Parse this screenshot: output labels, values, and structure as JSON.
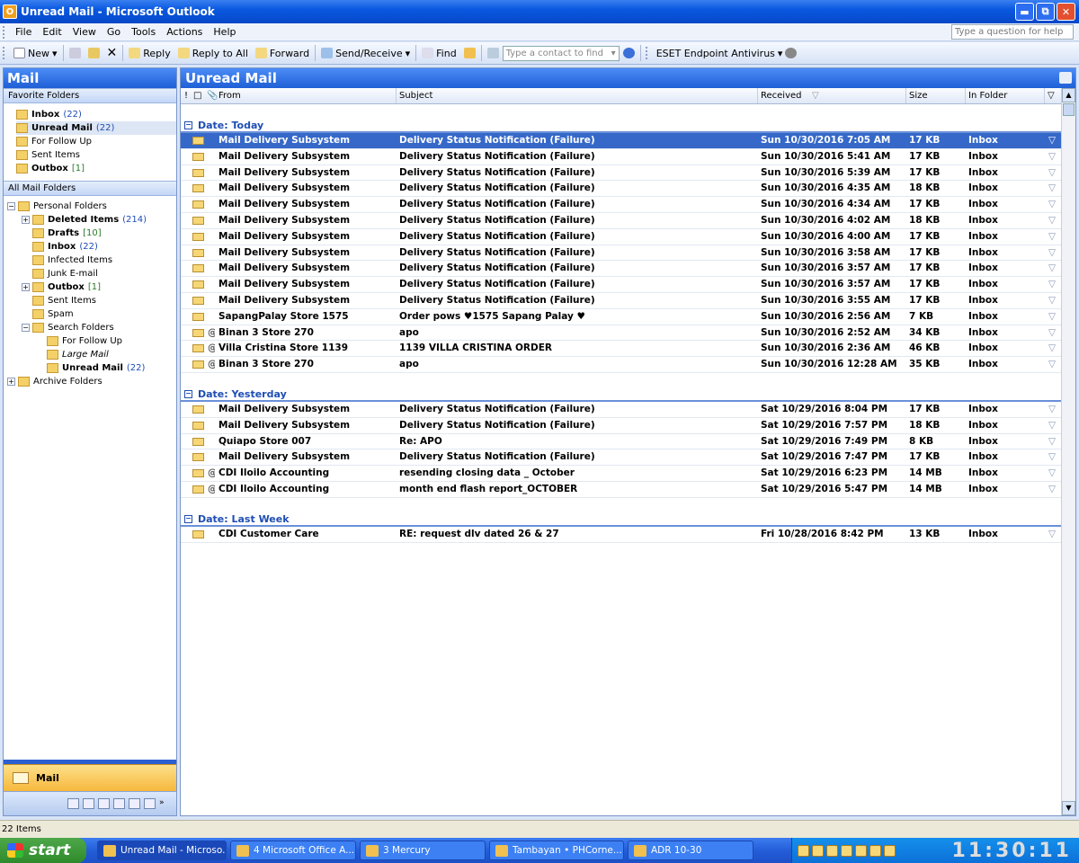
{
  "window": {
    "title": "Unread Mail - Microsoft Outlook",
    "app_glyph": "O"
  },
  "menu": [
    "File",
    "Edit",
    "View",
    "Go",
    "Tools",
    "Actions",
    "Help"
  ],
  "help_placeholder": "Type a question for help",
  "toolbar": {
    "new": "New",
    "reply": "Reply",
    "reply_all": "Reply to All",
    "forward": "Forward",
    "send_receive": "Send/Receive",
    "find": "Find",
    "contact_placeholder": "Type a contact to find",
    "eset": "ESET Endpoint Antivirus"
  },
  "nav": {
    "title": "Mail",
    "favorites_header": "Favorite Folders",
    "favorites": [
      {
        "label": "Inbox",
        "count": "(22)",
        "bold": true
      },
      {
        "label": "Unread Mail",
        "count": "(22)",
        "bold": true
      },
      {
        "label": "For Follow Up",
        "count": "",
        "bold": false
      },
      {
        "label": "Sent Items",
        "count": "",
        "bold": false
      },
      {
        "label": "Outbox",
        "count": "[1]",
        "bold": true
      }
    ],
    "all_header": "All Mail Folders",
    "tree": [
      {
        "label": "Personal Folders",
        "count": "",
        "bold": false,
        "level": 0,
        "exp": "⊟"
      },
      {
        "label": "Deleted Items",
        "count": "(214)",
        "bold": true,
        "level": 1,
        "exp": "⊞"
      },
      {
        "label": "Drafts",
        "count": "[10]",
        "bold": true,
        "level": 1,
        "exp": ""
      },
      {
        "label": "Inbox",
        "count": "(22)",
        "bold": true,
        "level": 1,
        "exp": ""
      },
      {
        "label": "Infected Items",
        "count": "",
        "bold": false,
        "level": 1,
        "exp": ""
      },
      {
        "label": "Junk E-mail",
        "count": "",
        "bold": false,
        "level": 1,
        "exp": ""
      },
      {
        "label": "Outbox",
        "count": "[1]",
        "bold": true,
        "level": 1,
        "exp": "⊞"
      },
      {
        "label": "Sent Items",
        "count": "",
        "bold": false,
        "level": 1,
        "exp": ""
      },
      {
        "label": "Spam",
        "count": "",
        "bold": false,
        "level": 1,
        "exp": ""
      },
      {
        "label": "Search Folders",
        "count": "",
        "bold": false,
        "level": 1,
        "exp": "⊟"
      },
      {
        "label": "For Follow Up",
        "count": "",
        "bold": false,
        "level": 2,
        "exp": ""
      },
      {
        "label": "Large Mail",
        "count": "",
        "bold": false,
        "level": 2,
        "exp": "",
        "italic": true
      },
      {
        "label": "Unread Mail",
        "count": "(22)",
        "bold": true,
        "level": 2,
        "exp": ""
      },
      {
        "label": "Archive Folders",
        "count": "",
        "bold": false,
        "level": 0,
        "exp": "⊞"
      }
    ],
    "mail_button": "Mail"
  },
  "list": {
    "title": "Unread Mail",
    "columns": {
      "from": "From",
      "subject": "Subject",
      "received": "Received",
      "size": "Size",
      "folder": "In Folder"
    },
    "groups": [
      {
        "label": "Date: Today",
        "rows": [
          {
            "from": "Mail Delivery Subsystem",
            "subject": "Delivery Status Notification (Failure)",
            "received": "Sun 10/30/2016 7:05 AM",
            "size": "17 KB",
            "folder": "Inbox",
            "attach": false,
            "selected": true
          },
          {
            "from": "Mail Delivery Subsystem",
            "subject": "Delivery Status Notification (Failure)",
            "received": "Sun 10/30/2016 5:41 AM",
            "size": "17 KB",
            "folder": "Inbox",
            "attach": false
          },
          {
            "from": "Mail Delivery Subsystem",
            "subject": "Delivery Status Notification (Failure)",
            "received": "Sun 10/30/2016 5:39 AM",
            "size": "17 KB",
            "folder": "Inbox",
            "attach": false
          },
          {
            "from": "Mail Delivery Subsystem",
            "subject": "Delivery Status Notification (Failure)",
            "received": "Sun 10/30/2016 4:35 AM",
            "size": "18 KB",
            "folder": "Inbox",
            "attach": false
          },
          {
            "from": "Mail Delivery Subsystem",
            "subject": "Delivery Status Notification (Failure)",
            "received": "Sun 10/30/2016 4:34 AM",
            "size": "17 KB",
            "folder": "Inbox",
            "attach": false
          },
          {
            "from": "Mail Delivery Subsystem",
            "subject": "Delivery Status Notification (Failure)",
            "received": "Sun 10/30/2016 4:02 AM",
            "size": "18 KB",
            "folder": "Inbox",
            "attach": false
          },
          {
            "from": "Mail Delivery Subsystem",
            "subject": "Delivery Status Notification (Failure)",
            "received": "Sun 10/30/2016 4:00 AM",
            "size": "17 KB",
            "folder": "Inbox",
            "attach": false
          },
          {
            "from": "Mail Delivery Subsystem",
            "subject": "Delivery Status Notification (Failure)",
            "received": "Sun 10/30/2016 3:58 AM",
            "size": "17 KB",
            "folder": "Inbox",
            "attach": false
          },
          {
            "from": "Mail Delivery Subsystem",
            "subject": "Delivery Status Notification (Failure)",
            "received": "Sun 10/30/2016 3:57 AM",
            "size": "17 KB",
            "folder": "Inbox",
            "attach": false
          },
          {
            "from": "Mail Delivery Subsystem",
            "subject": "Delivery Status Notification (Failure)",
            "received": "Sun 10/30/2016 3:57 AM",
            "size": "17 KB",
            "folder": "Inbox",
            "attach": false
          },
          {
            "from": "Mail Delivery Subsystem",
            "subject": "Delivery Status Notification (Failure)",
            "received": "Sun 10/30/2016 3:55 AM",
            "size": "17 KB",
            "folder": "Inbox",
            "attach": false
          },
          {
            "from": "SapangPalay Store 1575",
            "subject": "Order pows ♥1575 Sapang Palay ♥",
            "received": "Sun 10/30/2016 2:56 AM",
            "size": "7 KB",
            "folder": "Inbox",
            "attach": false
          },
          {
            "from": "Binan 3 Store 270",
            "subject": "apo",
            "received": "Sun 10/30/2016 2:52 AM",
            "size": "34 KB",
            "folder": "Inbox",
            "attach": true
          },
          {
            "from": "Villa Cristina Store 1139",
            "subject": "1139 VILLA CRISTINA ORDER",
            "received": "Sun 10/30/2016 2:36 AM",
            "size": "46 KB",
            "folder": "Inbox",
            "attach": true
          },
          {
            "from": "Binan 3 Store 270",
            "subject": "apo",
            "received": "Sun 10/30/2016 12:28 AM",
            "size": "35 KB",
            "folder": "Inbox",
            "attach": true
          }
        ]
      },
      {
        "label": "Date: Yesterday",
        "rows": [
          {
            "from": "Mail Delivery Subsystem",
            "subject": "Delivery Status Notification (Failure)",
            "received": "Sat 10/29/2016 8:04 PM",
            "size": "17 KB",
            "folder": "Inbox",
            "attach": false
          },
          {
            "from": "Mail Delivery Subsystem",
            "subject": "Delivery Status Notification (Failure)",
            "received": "Sat 10/29/2016 7:57 PM",
            "size": "18 KB",
            "folder": "Inbox",
            "attach": false
          },
          {
            "from": "Quiapo Store 007",
            "subject": "Re: APO",
            "received": "Sat 10/29/2016 7:49 PM",
            "size": "8 KB",
            "folder": "Inbox",
            "attach": false
          },
          {
            "from": "Mail Delivery Subsystem",
            "subject": "Delivery Status Notification (Failure)",
            "received": "Sat 10/29/2016 7:47 PM",
            "size": "17 KB",
            "folder": "Inbox",
            "attach": false
          },
          {
            "from": "CDI Iloilo Accounting",
            "subject": "resending closing data _ October",
            "received": "Sat 10/29/2016 6:23 PM",
            "size": "14 MB",
            "folder": "Inbox",
            "attach": true
          },
          {
            "from": "CDI Iloilo Accounting",
            "subject": "month end flash report_OCTOBER",
            "received": "Sat 10/29/2016 5:47 PM",
            "size": "14 MB",
            "folder": "Inbox",
            "attach": true
          }
        ]
      },
      {
        "label": "Date: Last Week",
        "rows": [
          {
            "from": "CDI Customer Care",
            "subject": "RE: request dlv dated 26 & 27",
            "received": "Fri 10/28/2016 8:42 PM",
            "size": "13 KB",
            "folder": "Inbox",
            "attach": false
          }
        ]
      }
    ]
  },
  "status": "22 Items",
  "taskbar": {
    "start": "start",
    "tasks": [
      {
        "label": "Unread Mail - Microso...",
        "active": true
      },
      {
        "label": "4 Microsoft Office A...",
        "active": false
      },
      {
        "label": "3 Mercury",
        "active": false
      },
      {
        "label": "Tambayan • PHCorne...",
        "active": false
      },
      {
        "label": "ADR 10-30",
        "active": false
      }
    ],
    "clock": "11:30:11"
  }
}
